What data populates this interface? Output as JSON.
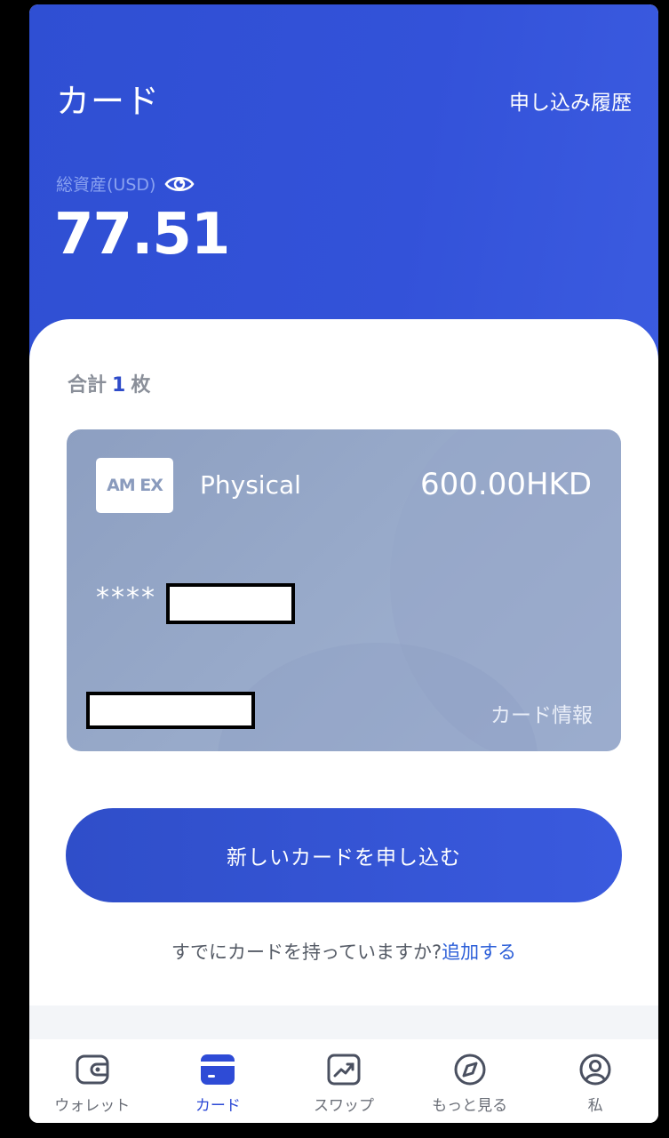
{
  "header": {
    "title": "カード",
    "history_link": "申し込み履歴",
    "asset_label": "総資産(USD)",
    "asset_value": "77.51"
  },
  "summary": {
    "prefix": "合計",
    "count": "1",
    "suffix": "枚"
  },
  "card": {
    "logo": "AM EX",
    "type": "Physical",
    "balance": "600.00HKD",
    "masked_number": "****",
    "info_link": "カード情報"
  },
  "actions": {
    "apply_button": "新しいカードを申し込む",
    "existing_prompt": "すでにカードを持っていますか?",
    "add_link": "追加する"
  },
  "tabs": [
    {
      "label": "ウォレット",
      "icon": "wallet-icon",
      "active": false
    },
    {
      "label": "カード",
      "icon": "card-icon",
      "active": true
    },
    {
      "label": "スワップ",
      "icon": "swap-chart-icon",
      "active": false
    },
    {
      "label": "もっと見る",
      "icon": "compass-icon",
      "active": false
    },
    {
      "label": "私",
      "icon": "profile-icon",
      "active": false
    }
  ],
  "colors": {
    "brand": "#3352d9",
    "active_tab": "#2e4bd6",
    "link": "#2b5ed8"
  }
}
